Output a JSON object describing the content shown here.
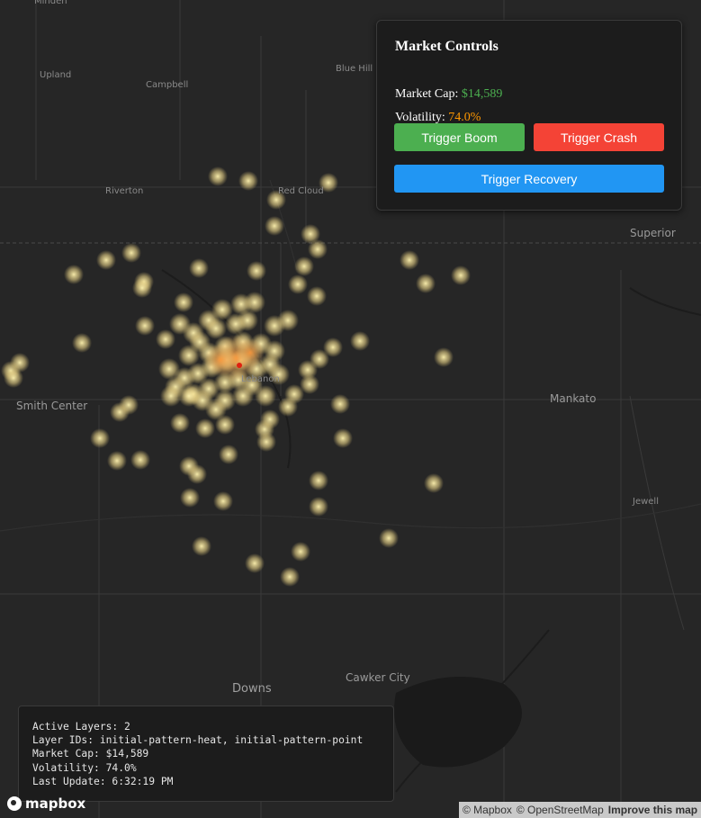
{
  "map": {
    "places": [
      {
        "name": "Minden",
        "cls": ""
      },
      {
        "name": "Upland",
        "cls": ""
      },
      {
        "name": "Campbell",
        "cls": ""
      },
      {
        "name": "Blue Hill",
        "cls": ""
      },
      {
        "name": "Riverton",
        "cls": ""
      },
      {
        "name": "Red Cloud",
        "cls": ""
      },
      {
        "name": "Superior",
        "cls": "big"
      },
      {
        "name": "Smith Center",
        "cls": "big"
      },
      {
        "name": "Lebanon",
        "cls": ""
      },
      {
        "name": "Mankato",
        "cls": "big"
      },
      {
        "name": "Jewell",
        "cls": ""
      },
      {
        "name": "Cawker City",
        "cls": "big"
      },
      {
        "name": "Downs",
        "cls": "huge"
      }
    ]
  },
  "controls": {
    "title": "Market Controls",
    "market_cap_label": "Market Cap: ",
    "market_cap_value": "$14,589",
    "volatility_label": "Volatility: ",
    "volatility_value": "74.0%",
    "boom_label": "Trigger Boom",
    "crash_label": "Trigger Crash",
    "recovery_label": "Trigger Recovery",
    "colors": {
      "boom": "#4caf50",
      "crash": "#f44336",
      "recovery": "#2196f3",
      "cap_value": "#4caf50",
      "vol_value": "#ff9800"
    }
  },
  "debug": {
    "lines": [
      "Active Layers: 2",
      "Layer IDs: initial-pattern-heat, initial-pattern-point",
      "Market Cap: $14,589",
      "Volatility: 74.0%",
      "Last Update: 6:32:19 PM"
    ]
  },
  "branding": {
    "logo_text": "mapbox",
    "attribution": [
      "© Mapbox",
      "© OpenStreetMap"
    ],
    "improve_link": "Improve this map"
  }
}
